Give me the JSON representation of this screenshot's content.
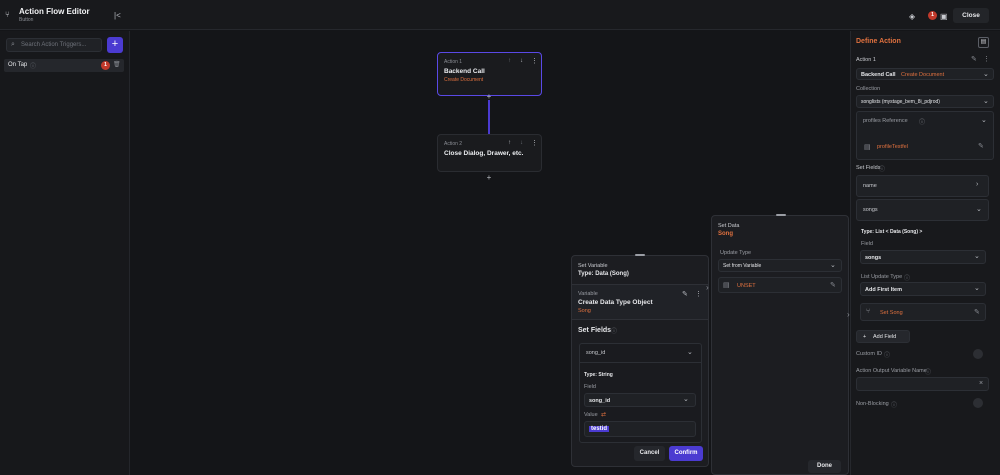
{
  "header": {
    "title": "Action Flow Editor",
    "subtitle": "Button",
    "badge_count": "1",
    "close_label": "Close"
  },
  "left": {
    "search_placeholder": "Search Action Triggers...",
    "add_label": "+",
    "trigger_label": "On Tap",
    "trigger_badge": "1"
  },
  "canvas": {
    "action1": {
      "label": "Action 1",
      "title": "Backend Call",
      "subtitle": "Create Document"
    },
    "action2": {
      "label": "Action 2",
      "title": "Close Dialog, Drawer, etc."
    },
    "plus": "+"
  },
  "right": {
    "title": "Define Action",
    "action_label": "Action 1",
    "action_type": "Backend Call",
    "action_sub": "Create Document",
    "collection_label": "Collection",
    "collection_value": "songlists (mystage_bem_8i_pdjrod)",
    "profiles_ref": "profiles Reference",
    "profile_testfel": "profileTestfel",
    "set_fields_label": "Set Fields",
    "field_name": "name",
    "field_songs": "songs",
    "type_label": "Type: List < Data (Song) >",
    "field_label": "Field",
    "field_value": "songs",
    "list_update_label": "List Update Type",
    "list_update_value": "Add First Item",
    "set_song": "Set Song",
    "add_field": "Add Field",
    "custom_id": "Custom ID",
    "action_output": "Action Output Variable Name",
    "non_blocking": "Non-Blocking"
  },
  "set_data": {
    "label": "Set Data",
    "title": "Song",
    "update_type_label": "Update Type",
    "update_type_value": "Set from Variable",
    "unset": "UNSET",
    "done": "Done"
  },
  "set_variable": {
    "label": "Set Variable",
    "type": "Type: Data (Song)",
    "variable_label": "Variable",
    "variable_title": "Create Data Type Object",
    "variable_sub": "Song",
    "set_fields": "Set Fields",
    "field_name": "song_id",
    "type_string": "Type: String",
    "field_label": "Field",
    "field_value": "song_id",
    "value_label": "Value",
    "value_text": "testid",
    "cancel": "Cancel",
    "confirm": "Confirm"
  },
  "colors": {
    "accent": "#4b3bd1",
    "orange": "#e0713f",
    "badge": "#c0392b"
  }
}
